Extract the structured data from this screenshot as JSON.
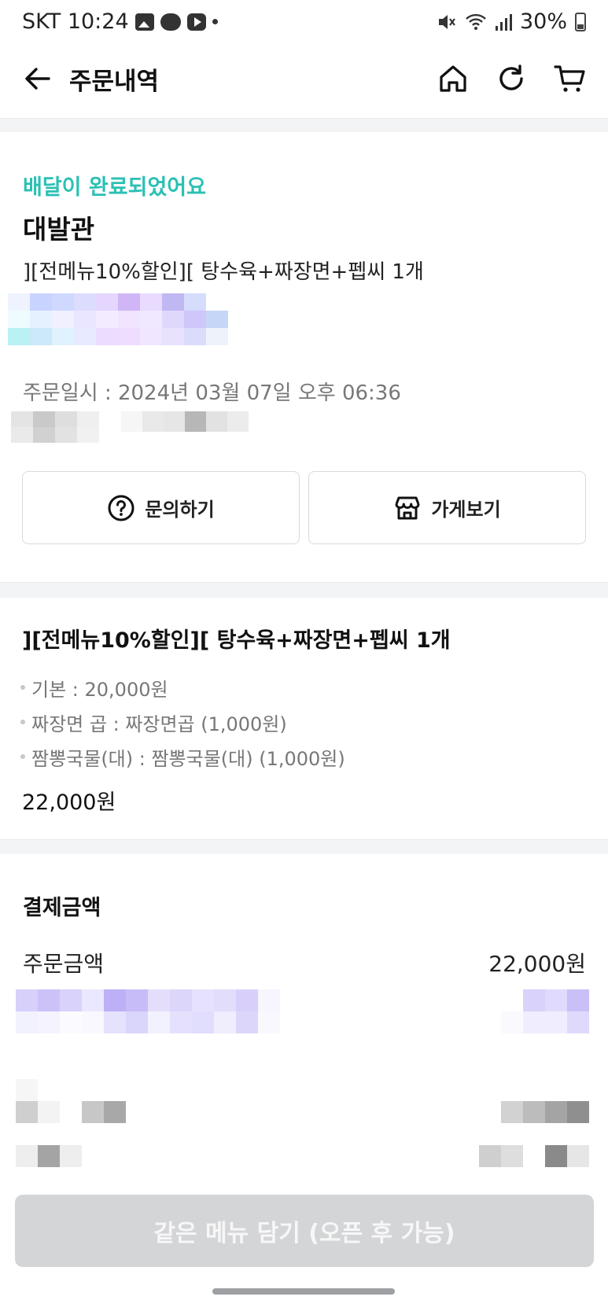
{
  "status_bar": {
    "carrier_time": "SKT 10:24",
    "battery": "30%"
  },
  "header": {
    "title": "주문내역"
  },
  "order": {
    "status": "배달이 완료되었어요",
    "store_name": "대발관",
    "summary": "][전메뉴10%할인][ 탕수육+짜장면+펩씨 1개",
    "order_datetime": "주문일시 : 2024년 03월 07일 오후 06:36",
    "buttons": {
      "inquiry": "문의하기",
      "view_store": "가게보기"
    }
  },
  "menu": {
    "name": "][전메뉴10%할인][ 탕수육+짜장면+펩씨 1개",
    "options": [
      "기본 : 20,000원",
      "짜장면 곱 : 짜장면곱 (1,000원)",
      "짬뽕국물(대) : 짬뽕국물(대) (1,000원)"
    ],
    "price": "22,000원"
  },
  "payment": {
    "title": "결제금액",
    "order_amount_label": "주문금액",
    "order_amount_value": "22,000원"
  },
  "bottom": {
    "reorder_label": "같은 메뉴 담기 (오픈 후 가능)"
  },
  "colors": {
    "accent": "#2bc0b4",
    "disabled_button": "#d4d5d7",
    "band": "#f3f4f6"
  },
  "icons": [
    "back-arrow-icon",
    "home-icon",
    "refresh-icon",
    "cart-icon",
    "question-circle-icon",
    "store-icon"
  ]
}
